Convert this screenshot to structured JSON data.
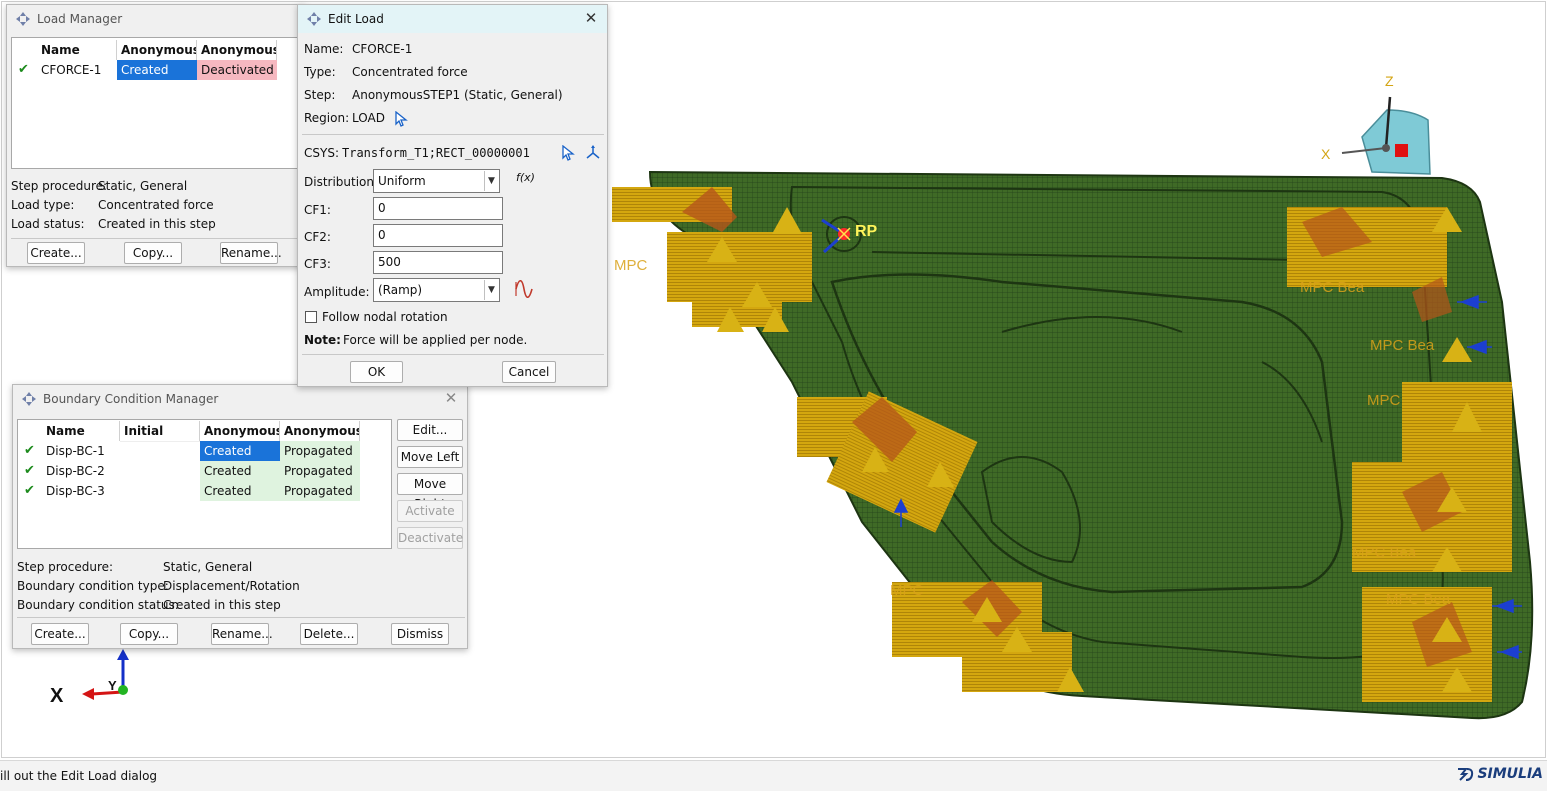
{
  "load_manager": {
    "title": "Load Manager",
    "columns": [
      "Name",
      "AnonymousST",
      "AnonymousST"
    ],
    "row": {
      "name": "CFORCE-1",
      "step1": "Created",
      "step2": "Deactivated"
    },
    "info": {
      "procedure_label": "Step procedure:",
      "procedure_value": "Static, General",
      "type_label": "Load type:",
      "type_value": "Concentrated force",
      "status_label": "Load status:",
      "status_value": "Created in this step"
    },
    "buttons": {
      "create": "Create...",
      "copy": "Copy...",
      "rename": "Rename..."
    }
  },
  "edit_load": {
    "title": "Edit Load",
    "name_label": "Name:",
    "name_value": "CFORCE-1",
    "type_label": "Type:",
    "type_value": "Concentrated force",
    "step_label": "Step:",
    "step_value": "AnonymousSTEP1 (Static, General)",
    "region_label": "Region:",
    "region_value": "LOAD",
    "csys_label": "CSYS:",
    "csys_value": "Transform_T1;RECT_00000001",
    "distribution_label": "Distribution:",
    "distribution_value": "Uniform",
    "fx_label": "f(x)",
    "cf1_label": "CF1:",
    "cf1_value": "0",
    "cf2_label": "CF2:",
    "cf2_value": "0",
    "cf3_label": "CF3:",
    "cf3_value": "500",
    "amplitude_label": "Amplitude:",
    "amplitude_value": "(Ramp)",
    "follow_label": "Follow nodal rotation",
    "note_label": "Note:",
    "note_value": "Force will be applied per node.",
    "ok": "OK",
    "cancel": "Cancel"
  },
  "bc_manager": {
    "title": "Boundary Condition Manager",
    "columns": [
      "Name",
      "Initial",
      "AnonymousST",
      "AnonymousST"
    ],
    "rows": [
      {
        "name": "Disp-BC-1",
        "initial": "",
        "step1": "Created",
        "step2": "Propagated"
      },
      {
        "name": "Disp-BC-2",
        "initial": "",
        "step1": "Created",
        "step2": "Propagated"
      },
      {
        "name": "Disp-BC-3",
        "initial": "",
        "step1": "Created",
        "step2": "Propagated"
      }
    ],
    "side_buttons": {
      "edit": "Edit...",
      "move_left": "Move Left",
      "move_right": "Move Right",
      "activate": "Activate",
      "deactivate": "Deactivate"
    },
    "info": {
      "procedure_label": "Step procedure:",
      "procedure_value": "Static, General",
      "type_label": "Boundary condition type:",
      "type_value": "Displacement/Rotation",
      "status_label": "Boundary condition status:",
      "status_value": "Created in this step"
    },
    "buttons": {
      "create": "Create...",
      "copy": "Copy...",
      "rename": "Rename...",
      "delete": "Delete...",
      "dismiss": "Dismiss"
    }
  },
  "viewport": {
    "rp_label": "RP",
    "mpc_labels": [
      "MPC Bea",
      "MPC Bea",
      "MPC",
      "MPC Bea",
      "MPC",
      "MPC",
      "MPC Bea"
    ],
    "triad_top": {
      "x": "X",
      "z": "Z"
    },
    "triad_bottom": {
      "x": "X",
      "y": "Y"
    }
  },
  "status": {
    "prompt": "ill out the Edit Load dialog",
    "brand": "SIMULIA"
  },
  "colors": {
    "mesh_green": "#3f6a26",
    "load_arrow": "#c9a012",
    "selection_blue": "#1a73d9",
    "deactivated_pink": "#f6b8c0",
    "propagated_green": "#dff3df"
  }
}
